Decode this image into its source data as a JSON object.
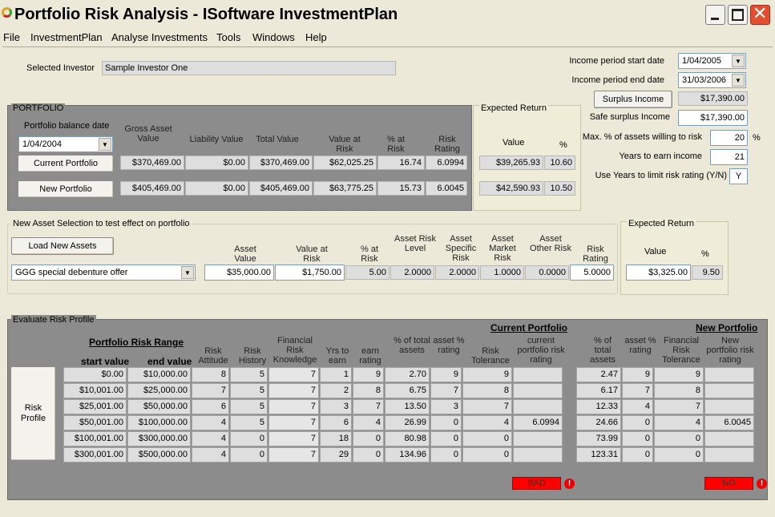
{
  "window": {
    "title": "Portfolio Risk Analysis - ISoftware InvestmentPlan",
    "minimize_icon": "minimize-icon",
    "maximize_icon": "maximize-icon",
    "close_icon": "close-icon",
    "app_icon": "isoftware-logo-icon"
  },
  "menu": [
    "File",
    "InvestmentPlan",
    "Analyse Investments",
    "Tools",
    "Windows",
    "Help"
  ],
  "investor": {
    "label": "Selected Investor",
    "value": "Sample Investor One"
  },
  "income": {
    "start_label": "Income period start date",
    "start_value": "1/04/2005",
    "end_label": "Income period end date",
    "end_value": "31/03/2006",
    "surplus_button": "Surplus Income",
    "surplus_value": "$17,390.00",
    "safe_label": "Safe surplus Income",
    "safe_value": "$17,390.00",
    "max_label": "Max. % of assets willing to risk",
    "max_value": "20",
    "max_unit": "%",
    "years_label": "Years to earn income",
    "years_value": "21",
    "use_years_label": "Use Years to limit risk rating (Y/N)",
    "use_years_value": "Y"
  },
  "portfolio": {
    "legend": "PORTFOLIO",
    "balance_date_label": "Portfolio balance date",
    "balance_date_value": "1/04/2004",
    "headers": {
      "gross": "Gross Asset Value",
      "liability": "Liability Value",
      "total": "Total Value",
      "var": "Value at Risk",
      "pct": "% at Risk",
      "rating": "Risk Rating"
    },
    "current_button": "Current Portfolio",
    "new_button": "New Portfolio",
    "current_row": [
      "$370,469.00",
      "$0.00",
      "$370,469.00",
      "$62,025.25",
      "16.74",
      "6.0994"
    ],
    "new_row": [
      "$405,469.00",
      "$0.00",
      "$405,469.00",
      "$63,775.25",
      "15.73",
      "6.0045"
    ],
    "expected": {
      "legend": "Expected Return",
      "value_label": "Value",
      "pct_label": "%",
      "current_value": "$39,265.93",
      "current_pct": "10.60",
      "new_value": "$42,590.93",
      "new_pct": "10.50"
    }
  },
  "new_asset": {
    "legend": "New Asset Selection to test effect on portfolio",
    "load_button": "Load New Assets",
    "selected_asset": "GGG special debenture offer",
    "headers": {
      "asset_value": "Asset Value",
      "var": "Value at Risk",
      "pct": "% at Risk",
      "risk_level": "Asset Risk Level",
      "specific": "Asset Specific Risk",
      "market": "Asset Market Risk",
      "other": "Asset Other Risk",
      "rating": "Risk Rating"
    },
    "values": [
      "$35,000.00",
      "$1,750.00",
      "5.00",
      "2.0000",
      "2.0000",
      "1.0000",
      "0.0000",
      "5.0000"
    ],
    "expected": {
      "legend": "Expected Return",
      "value_label": "Value",
      "pct_label": "%",
      "value": "$3,325.00",
      "pct": "9.50"
    }
  },
  "evaluate": {
    "legend": "Evaluate Risk Profile",
    "range_title": "Portfolio Risk Range",
    "start_label": "start value",
    "end_label": "end value",
    "current_title": "Current Portfolio",
    "new_title": "New Portfolio",
    "risk_profile_button": "Risk Profile",
    "headers": {
      "attitude": "Risk Attitude",
      "history": "Risk History",
      "knowledge": "Financial Risk Knowledge",
      "yrs": "Yrs to earn",
      "earn": "earn rating",
      "pct_total": "% of total assets",
      "asset_pct": "asset % rating",
      "tolerance": "Risk Tolerance",
      "cur_rating": "current portfolio risk rating",
      "new_pct_total": "% of total assets",
      "new_asset_pct": "asset % rating",
      "new_tolerance": "Financial Risk Tolerance",
      "new_rating": "New portfolio risk rating"
    },
    "rows": [
      [
        "$0.00",
        "$10,000.00",
        "8",
        "5",
        "7",
        "1",
        "9",
        "2.70",
        "9",
        "9",
        "",
        "2.47",
        "9",
        "9",
        ""
      ],
      [
        "$10,001.00",
        "$25,000.00",
        "7",
        "5",
        "7",
        "2",
        "8",
        "6.75",
        "7",
        "8",
        "",
        "6.17",
        "7",
        "8",
        ""
      ],
      [
        "$25,001.00",
        "$50,000.00",
        "6",
        "5",
        "7",
        "3",
        "7",
        "13.50",
        "3",
        "7",
        "",
        "12.33",
        "4",
        "7",
        ""
      ],
      [
        "$50,001.00",
        "$100,000.00",
        "4",
        "5",
        "7",
        "6",
        "4",
        "26.99",
        "0",
        "4",
        "6.0994",
        "24.66",
        "0",
        "4",
        "6.0045"
      ],
      [
        "$100,001.00",
        "$300,000.00",
        "4",
        "0",
        "7",
        "18",
        "0",
        "80.98",
        "0",
        "0",
        "",
        "73.99",
        "0",
        "0",
        ""
      ],
      [
        "$300,001.00",
        "$500,000.00",
        "4",
        "0",
        "7",
        "29",
        "0",
        "134.96",
        "0",
        "0",
        "",
        "123.31",
        "0",
        "0",
        ""
      ]
    ],
    "current_status": "BAD",
    "new_status": "NO",
    "warn_icon": "warning-icon"
  }
}
